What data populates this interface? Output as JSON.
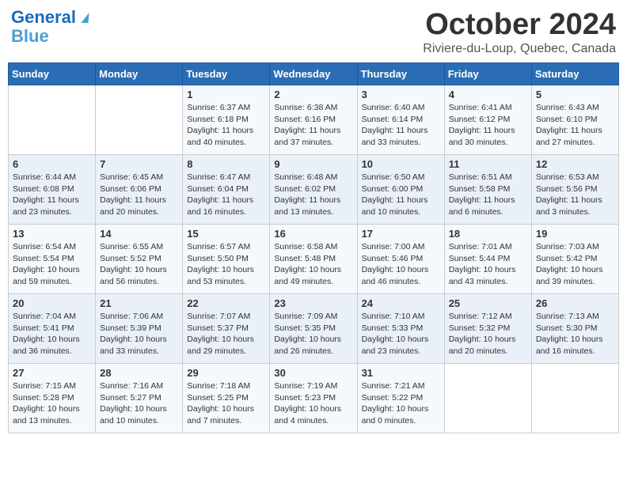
{
  "logo": {
    "line1": "General",
    "line2": "Blue"
  },
  "title": "October 2024",
  "location": "Riviere-du-Loup, Quebec, Canada",
  "header_days": [
    "Sunday",
    "Monday",
    "Tuesday",
    "Wednesday",
    "Thursday",
    "Friday",
    "Saturday"
  ],
  "weeks": [
    [
      {
        "day": "",
        "info": ""
      },
      {
        "day": "",
        "info": ""
      },
      {
        "day": "1",
        "info": "Sunrise: 6:37 AM\nSunset: 6:18 PM\nDaylight: 11 hours and 40 minutes."
      },
      {
        "day": "2",
        "info": "Sunrise: 6:38 AM\nSunset: 6:16 PM\nDaylight: 11 hours and 37 minutes."
      },
      {
        "day": "3",
        "info": "Sunrise: 6:40 AM\nSunset: 6:14 PM\nDaylight: 11 hours and 33 minutes."
      },
      {
        "day": "4",
        "info": "Sunrise: 6:41 AM\nSunset: 6:12 PM\nDaylight: 11 hours and 30 minutes."
      },
      {
        "day": "5",
        "info": "Sunrise: 6:43 AM\nSunset: 6:10 PM\nDaylight: 11 hours and 27 minutes."
      }
    ],
    [
      {
        "day": "6",
        "info": "Sunrise: 6:44 AM\nSunset: 6:08 PM\nDaylight: 11 hours and 23 minutes."
      },
      {
        "day": "7",
        "info": "Sunrise: 6:45 AM\nSunset: 6:06 PM\nDaylight: 11 hours and 20 minutes."
      },
      {
        "day": "8",
        "info": "Sunrise: 6:47 AM\nSunset: 6:04 PM\nDaylight: 11 hours and 16 minutes."
      },
      {
        "day": "9",
        "info": "Sunrise: 6:48 AM\nSunset: 6:02 PM\nDaylight: 11 hours and 13 minutes."
      },
      {
        "day": "10",
        "info": "Sunrise: 6:50 AM\nSunset: 6:00 PM\nDaylight: 11 hours and 10 minutes."
      },
      {
        "day": "11",
        "info": "Sunrise: 6:51 AM\nSunset: 5:58 PM\nDaylight: 11 hours and 6 minutes."
      },
      {
        "day": "12",
        "info": "Sunrise: 6:53 AM\nSunset: 5:56 PM\nDaylight: 11 hours and 3 minutes."
      }
    ],
    [
      {
        "day": "13",
        "info": "Sunrise: 6:54 AM\nSunset: 5:54 PM\nDaylight: 10 hours and 59 minutes."
      },
      {
        "day": "14",
        "info": "Sunrise: 6:55 AM\nSunset: 5:52 PM\nDaylight: 10 hours and 56 minutes."
      },
      {
        "day": "15",
        "info": "Sunrise: 6:57 AM\nSunset: 5:50 PM\nDaylight: 10 hours and 53 minutes."
      },
      {
        "day": "16",
        "info": "Sunrise: 6:58 AM\nSunset: 5:48 PM\nDaylight: 10 hours and 49 minutes."
      },
      {
        "day": "17",
        "info": "Sunrise: 7:00 AM\nSunset: 5:46 PM\nDaylight: 10 hours and 46 minutes."
      },
      {
        "day": "18",
        "info": "Sunrise: 7:01 AM\nSunset: 5:44 PM\nDaylight: 10 hours and 43 minutes."
      },
      {
        "day": "19",
        "info": "Sunrise: 7:03 AM\nSunset: 5:42 PM\nDaylight: 10 hours and 39 minutes."
      }
    ],
    [
      {
        "day": "20",
        "info": "Sunrise: 7:04 AM\nSunset: 5:41 PM\nDaylight: 10 hours and 36 minutes."
      },
      {
        "day": "21",
        "info": "Sunrise: 7:06 AM\nSunset: 5:39 PM\nDaylight: 10 hours and 33 minutes."
      },
      {
        "day": "22",
        "info": "Sunrise: 7:07 AM\nSunset: 5:37 PM\nDaylight: 10 hours and 29 minutes."
      },
      {
        "day": "23",
        "info": "Sunrise: 7:09 AM\nSunset: 5:35 PM\nDaylight: 10 hours and 26 minutes."
      },
      {
        "day": "24",
        "info": "Sunrise: 7:10 AM\nSunset: 5:33 PM\nDaylight: 10 hours and 23 minutes."
      },
      {
        "day": "25",
        "info": "Sunrise: 7:12 AM\nSunset: 5:32 PM\nDaylight: 10 hours and 20 minutes."
      },
      {
        "day": "26",
        "info": "Sunrise: 7:13 AM\nSunset: 5:30 PM\nDaylight: 10 hours and 16 minutes."
      }
    ],
    [
      {
        "day": "27",
        "info": "Sunrise: 7:15 AM\nSunset: 5:28 PM\nDaylight: 10 hours and 13 minutes."
      },
      {
        "day": "28",
        "info": "Sunrise: 7:16 AM\nSunset: 5:27 PM\nDaylight: 10 hours and 10 minutes."
      },
      {
        "day": "29",
        "info": "Sunrise: 7:18 AM\nSunset: 5:25 PM\nDaylight: 10 hours and 7 minutes."
      },
      {
        "day": "30",
        "info": "Sunrise: 7:19 AM\nSunset: 5:23 PM\nDaylight: 10 hours and 4 minutes."
      },
      {
        "day": "31",
        "info": "Sunrise: 7:21 AM\nSunset: 5:22 PM\nDaylight: 10 hours and 0 minutes."
      },
      {
        "day": "",
        "info": ""
      },
      {
        "day": "",
        "info": ""
      }
    ]
  ]
}
